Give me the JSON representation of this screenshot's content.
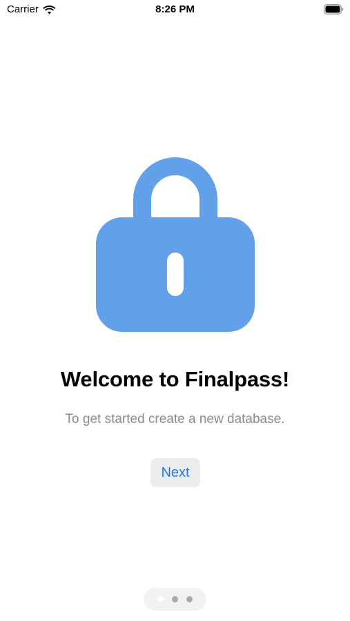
{
  "status_bar": {
    "carrier": "Carrier",
    "time": "8:26 PM",
    "wifi_icon": "wifi-icon",
    "battery_icon": "battery-full-icon"
  },
  "onboarding": {
    "illustration_icon": "lock-icon",
    "illustration_color": "#62a0ea",
    "title": "Welcome to Finalpass!",
    "subtitle": "To get started create a new database.",
    "next_button_label": "Next",
    "accent_color": "#1a7cf0"
  },
  "page_control": {
    "page_count": 3,
    "current_page": 1
  }
}
